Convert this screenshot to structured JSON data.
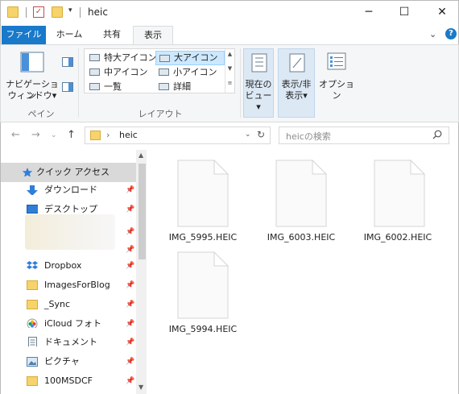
{
  "window": {
    "title": "heic"
  },
  "ribbon_tabs": {
    "file": "ファイル",
    "home": "ホーム",
    "share": "共有",
    "view": "表示"
  },
  "ribbon": {
    "pane_group": {
      "label": "ペイン",
      "nav_pane_line1": "ナビゲーション",
      "nav_pane_line2": "ウィンドウ▾"
    },
    "layout_group": {
      "label": "レイアウト",
      "items": [
        "特大アイコン",
        "大アイコン",
        "中アイコン",
        "小アイコン",
        "一覧",
        "詳細"
      ],
      "selected": "大アイコン"
    },
    "current_view": {
      "line1": "現在の",
      "line2": "ビュー▾"
    },
    "show_hide": {
      "line1": "表示/非",
      "line2": "表示▾"
    },
    "options": {
      "label": "オプション"
    }
  },
  "address": {
    "path": "heic",
    "search_placeholder": "heicの検索"
  },
  "nav_pane": {
    "items": [
      {
        "label": "クイック アクセス",
        "icon": "star-icon",
        "selected": true,
        "pinned": false
      },
      {
        "label": "ダウンロード",
        "icon": "download-icon",
        "pinned": true
      },
      {
        "label": "デスクトップ",
        "icon": "desktop-icon",
        "pinned": true
      },
      {
        "label": "Dropbox",
        "icon": "dropbox-icon",
        "pinned": true
      },
      {
        "label": "ImagesForBlog",
        "icon": "folder-icon",
        "pinned": true
      },
      {
        "label": "_Sync",
        "icon": "folder-icon",
        "pinned": true
      },
      {
        "label": "iCloud フォト",
        "icon": "icloud-photos-icon",
        "pinned": true
      },
      {
        "label": "ドキュメント",
        "icon": "documents-icon",
        "pinned": true
      },
      {
        "label": "ピクチャ",
        "icon": "pictures-icon",
        "pinned": true
      },
      {
        "label": "100MSDCF",
        "icon": "folder-icon",
        "pinned": true
      }
    ]
  },
  "files": [
    {
      "name": "IMG_5995.HEIC"
    },
    {
      "name": "IMG_6003.HEIC"
    },
    {
      "name": "IMG_6002.HEIC"
    },
    {
      "name": "IMG_5994.HEIC"
    }
  ],
  "colors": {
    "accent": "#1979ca",
    "selection": "#cce8ff",
    "folder": "#f6d36b"
  }
}
